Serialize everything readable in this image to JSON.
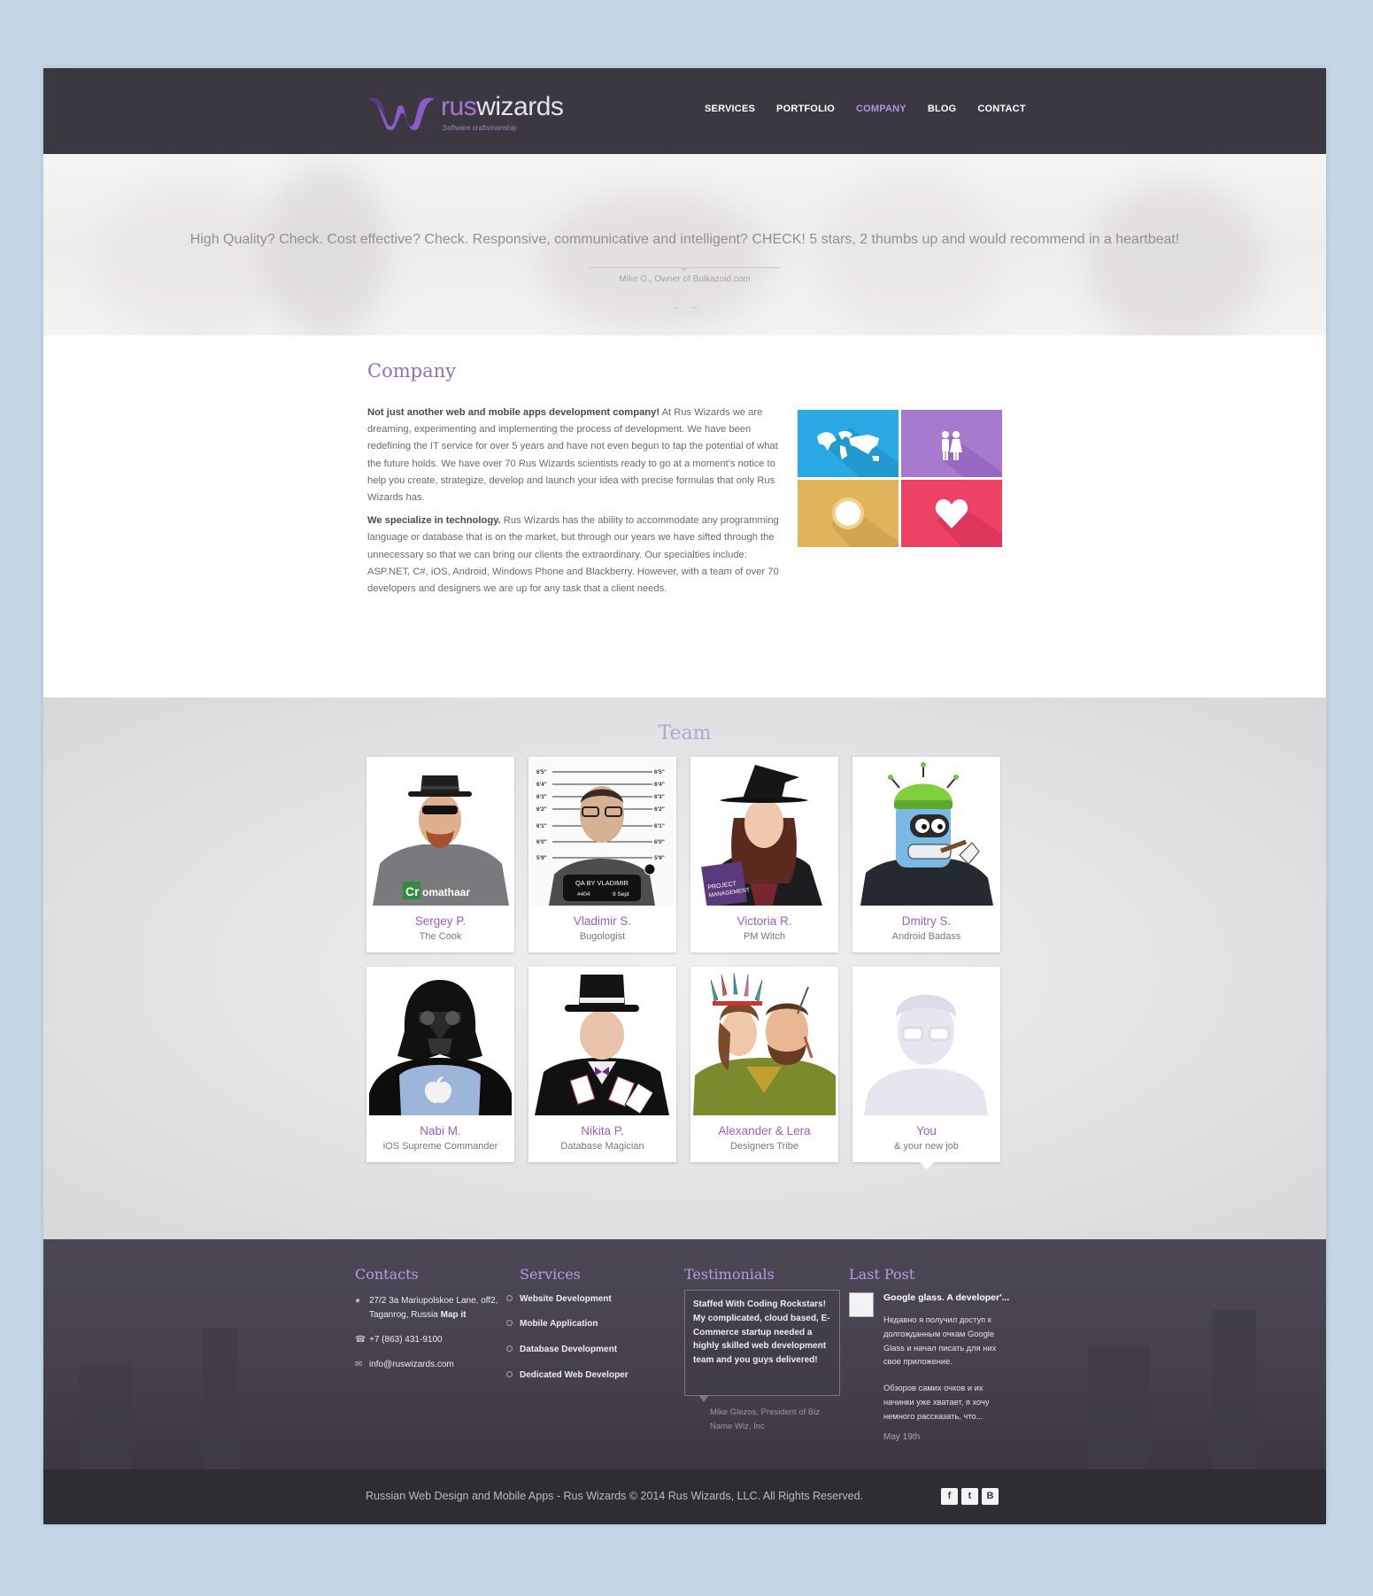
{
  "brand": {
    "name_part1": "rus",
    "name_part2": "wizards",
    "tagline": "Software craftsmanship"
  },
  "nav": {
    "items": [
      "SERVICES",
      "PORTFOLIO",
      "COMPANY",
      "BLOG",
      "CONTACT"
    ],
    "active": "COMPANY"
  },
  "hero": {
    "quote": "High Quality? Check. Cost effective? Check. Responsive, communicative and intelligent? CHECK! 5 stars, 2 thumbs up and would recommend in a heartbeat!",
    "author": "Mike G., Owner of Bulkazoid.com",
    "prev": "←",
    "next": "→"
  },
  "company": {
    "title": "Company",
    "p1_lead": "Not just another web and mobile apps development company!",
    "p1_body": " At Rus Wizards we are dreaming, experimenting and implementing the process of development. We have been redefining the IT service for over 5 years and have not even begun to tap the potential of what the future holds. We have over 70 Rus Wizards scientists ready to go at a moment's notice to help you create, strategize, develop and launch your idea with precise formulas that only Rus Wizards has.",
    "p2_lead": "We specialize in technology.",
    "p2_body": " Rus Wizards has the ability to accommodate any programming language or database that is on the market, but through our years we have sifted through the unnecessary so that we can bring our clients the extraordinary. Our specialties include: ASP.NET, C#, iOS, Android, Windows Phone and Blackberry. However, with a team of over 70 developers and designers we are up for any task that a client needs.",
    "tiles": [
      {
        "icon": "world-map-icon",
        "color": "#2aa9e5"
      },
      {
        "icon": "people-icon",
        "color": "#a779cf"
      },
      {
        "icon": "badge-icon",
        "color": "#dfb45a"
      },
      {
        "icon": "heart-icon",
        "color": "#ee4166"
      }
    ]
  },
  "team": {
    "title": "Team",
    "members": [
      {
        "name": "Sergey P.",
        "role": "The Cook",
        "photo_text": "Cr omathaar"
      },
      {
        "name": "Vladimir S.",
        "role": "Bugologist",
        "photo_text": "QA BY VLADIMIR",
        "photo_text2": "#404",
        "photo_text3": "9 Sept"
      },
      {
        "name": "Victoria R.",
        "role": "PM Witch",
        "photo_text": "PROJECT MANAGEMENT"
      },
      {
        "name": "Dmitry S.",
        "role": "Android Badass"
      },
      {
        "name": "Nabi M.",
        "role": "iOS Supreme Commander"
      },
      {
        "name": "Nikita P.",
        "role": "Database Magician"
      },
      {
        "name": "Alexander & Lera",
        "role": "Designers Tribe"
      },
      {
        "name": "You",
        "role": "& your new job"
      }
    ],
    "height_marks": [
      "6'5\"",
      "6'4\"",
      "6'3\"",
      "6'2\"",
      "6'1\"",
      "6'0\"",
      "5'9\""
    ]
  },
  "footer": {
    "contacts": {
      "title": "Contacts",
      "address_line1": "27/2 3a Mariupolskoe Lane, off2,",
      "address_line2": "Taganrog, Russia",
      "map_link": "Map it",
      "phone": "+7 (863) 431-9100",
      "email": "info@ruswizards.com"
    },
    "services": {
      "title": "Services",
      "items": [
        "Website Development",
        "Mobile Application",
        "Database Development",
        "Dedicated Web Developer"
      ]
    },
    "testimonials": {
      "title": "Testimonials",
      "text": "Staffed With Coding Rockstars! My complicated, cloud based, E-Commerce startup needed a highly skilled web development team and you guys delivered!",
      "author_line1": "Mike Glezos, President of Biz",
      "author_line2": "Name Wiz, Inc"
    },
    "last_post": {
      "title": "Last Post",
      "post_title": "Google glass. A developer'...",
      "p1": "Недавно я получил доступ к долгожданным очкам Google Glass и начал писать для них свое приложение.",
      "p2": "Обзоров самих очков и их начинки уже хватает, я хочу немного рассказать, что...",
      "date": "May 19th"
    }
  },
  "bottom": {
    "copyright": "Russian Web Design and Mobile Apps - Rus Wizards © 2014 Rus Wizards, LLC. All Rights Reserved.",
    "social": [
      "f",
      "t",
      "B"
    ]
  }
}
